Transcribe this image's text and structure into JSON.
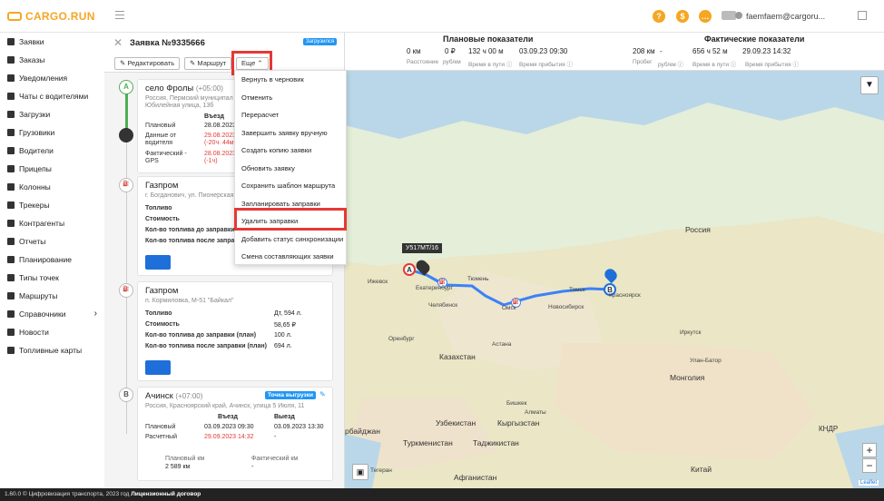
{
  "app": {
    "logo": "CARGO.RUN",
    "user": "faemfaem@cargoru..."
  },
  "sidebar": {
    "items": [
      {
        "label": "Заявки"
      },
      {
        "label": "Заказы"
      },
      {
        "label": "Уведомления"
      },
      {
        "label": "Чаты с водителями"
      },
      {
        "label": "Загрузки"
      },
      {
        "label": "Грузовики"
      },
      {
        "label": "Водители"
      },
      {
        "label": "Прицепы"
      },
      {
        "label": "Колонны"
      },
      {
        "label": "Трекеры"
      },
      {
        "label": "Контрагенты"
      },
      {
        "label": "Отчеты"
      },
      {
        "label": "Планирование"
      },
      {
        "label": "Типы точек"
      },
      {
        "label": "Маршруты"
      },
      {
        "label": "Справочники"
      },
      {
        "label": "Новости"
      },
      {
        "label": "Топливные карты"
      }
    ]
  },
  "order": {
    "title": "Заявка №9335666",
    "status": "Загрузился",
    "btn_edit": "Редактировать",
    "btn_route": "Маршрут",
    "btn_more": "Еще ⌃"
  },
  "menu": {
    "items": [
      "Вернуть в черновик",
      "Отменить",
      "Перерасчет",
      "Завершить заявку вручную",
      "Создать копию заявки",
      "Обновить заявку",
      "Сохранить шаблон маршрута",
      "Запланировать заправки",
      "Удалить заправки",
      "Добавить статус синхронизации",
      "Смена составляющих заявки"
    ]
  },
  "point_a": {
    "marker": "A",
    "title": "село Фролы",
    "tz": "(+05:00)",
    "addr1": "Россия, Пермский муниципал",
    "addr2": "Юбилейная улица, 13б",
    "col_in": "Въезд",
    "plan_label": "Плановый",
    "plan_val": "28.08.2023",
    "driver_label1": "Данные от",
    "driver_label2": "водителя",
    "driver_val1": "29.08.2023",
    "driver_val2": "(-20ч. 44м",
    "gps_label1": "Фактический -",
    "gps_label2": "GPS",
    "gps_val1": "28.08.2023",
    "gps_val2": "(-1ч)"
  },
  "gas1": {
    "title": "Газпром",
    "addr": "г. Богданович, ул. Пионерская",
    "r1": "Топливо",
    "r2": "Стоимость",
    "r3": "Кол-во топлива до заправки (план)",
    "r4": "Кол-во топлива после заправки (план)"
  },
  "gas2": {
    "title": "Газпром",
    "addr": "п. Кормиловка, М-51 \"Байкал\"",
    "r1": "Топливо",
    "v1": "Дт, 594 л.",
    "r2": "Стоимость",
    "v2": "58,65 ₽",
    "r3": "Кол-во топлива до заправки (план)",
    "v3": "100 л.",
    "r4": "Кол-во топлива после заправки (план)",
    "v4": "694 л."
  },
  "point_b": {
    "marker": "B",
    "title": "Ачинск",
    "tz": "(+07:00)",
    "badge": "Точка выгрузки",
    "addr": "Россия, Красноярский край, Ачинск, улица 5 Июля, 11",
    "col_in": "Въезд",
    "col_out": "Выезд",
    "plan_label": "Плановый",
    "plan_in": "03.09.2023 09:30",
    "plan_out": "03.09.2023 13:30",
    "calc_label": "Расчетный",
    "calc_in": "29.09.2023 14:32",
    "calc_out": "-",
    "km_plan_label": "Плановый км",
    "km_plan": "2 589 км",
    "km_fact_label": "Фактический км",
    "km_fact": "-"
  },
  "summary": {
    "plan_title": "Плановые показатели",
    "fact_title": "Фактические показатели",
    "p_dist": "0 км",
    "p_rub": "0 ₽",
    "p_time": "132 ч 00 м",
    "p_arr": "03.09.23 09:30",
    "l_dist": "Расстояние",
    "l_rub": "руб/км",
    "l_time": "Время в пути ⓘ",
    "l_arr": "Время прибытия ⓘ",
    "f_dist": "208 км",
    "f_rub": "-",
    "f_time": "656 ч 52 м",
    "f_arr": "29.09.23 14:32",
    "lf_dist": "Пробег",
    "lf_rub": "руб/км ⓘ",
    "lf_time": "Время в пути ⓘ",
    "lf_arr": "Время прибытия ⓘ"
  },
  "map": {
    "truck": "У517МТ/16",
    "labels": {
      "russia": "Россия",
      "kazakhstan": "Казахстан",
      "mongolia": "Монголия",
      "uzbekistan": "Узбекистан",
      "kyrgyzstan": "Кыргызстан",
      "turkmenistan": "Туркменистан",
      "tajikistan": "Таджикистан",
      "afghanistan": "Афганистан",
      "china": "Китай",
      "kndr": "КНДР",
      "azerbaijan": "рбайджан",
      "tomsk": "Томск",
      "novosibirsk": "Новосибирск",
      "omsk": "Омск",
      "tyumen": "Тюмень",
      "chelyabinsk": "Челябинск",
      "ekb": "Екатеринбург",
      "krasnoyarsk": "Красноярск",
      "irkutsk": "Иркутск",
      "orenburg": "Оренбург",
      "izhevsk": "Ижевск",
      "astana": "Астана",
      "ulanbator": "Улан-Батор",
      "bishkek": "Бишкек",
      "almaty": "Алматы",
      "teheran": "Тегеран",
      "leaflet": "Leaflet"
    }
  },
  "footer": {
    "text": "1.60.0 © Цифровизация транспорта, 2023 год",
    "link": "Лицензионный договор"
  }
}
